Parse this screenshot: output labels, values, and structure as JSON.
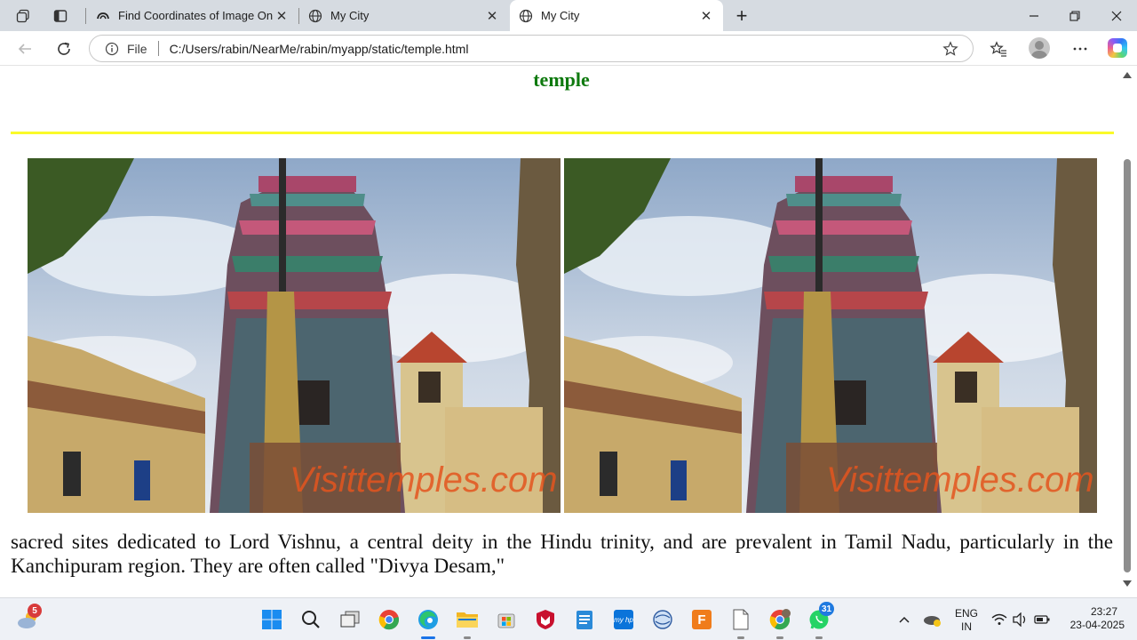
{
  "browser": {
    "tabs": [
      {
        "title": "Find Coordinates of Image Online",
        "active": false
      },
      {
        "title": "My City",
        "active": false
      },
      {
        "title": "My City",
        "active": true
      }
    ],
    "address": {
      "scheme_label": "File",
      "url": "C:/Users/rabin/NearMe/rabin/myapp/static/temple.html"
    }
  },
  "page": {
    "heading": "temple",
    "rule_color": "#fafa29",
    "heading_color": "#0f7a0f",
    "images": [
      {
        "name": "temple-photo-1",
        "watermark": "Visittemples.com"
      },
      {
        "name": "temple-photo-2",
        "watermark": "Visittemples.com"
      }
    ],
    "paragraph": "sacred sites dedicated to Lord Vishnu, a central deity in the Hindu trinity, and are prevalent in Tamil Nadu, particularly in the Kanchipuram region. They are often called \"Divya Desam,\""
  },
  "taskbar": {
    "weather_badge": "5",
    "whatsapp_badge": "31",
    "language_line1": "ENG",
    "language_line2": "IN",
    "time": "23:27",
    "date": "23-04-2025",
    "icons": [
      "weather-icon",
      "start-icon",
      "search-icon",
      "task-view-icon",
      "chrome-icon",
      "edge-icon",
      "file-explorer-icon",
      "store-icon",
      "mcafee-icon",
      "notes-icon",
      "myhp-icon",
      "network-tool-icon",
      "fresh-app-icon",
      "file-icon",
      "chrome-profile-icon",
      "whatsapp-icon"
    ]
  }
}
